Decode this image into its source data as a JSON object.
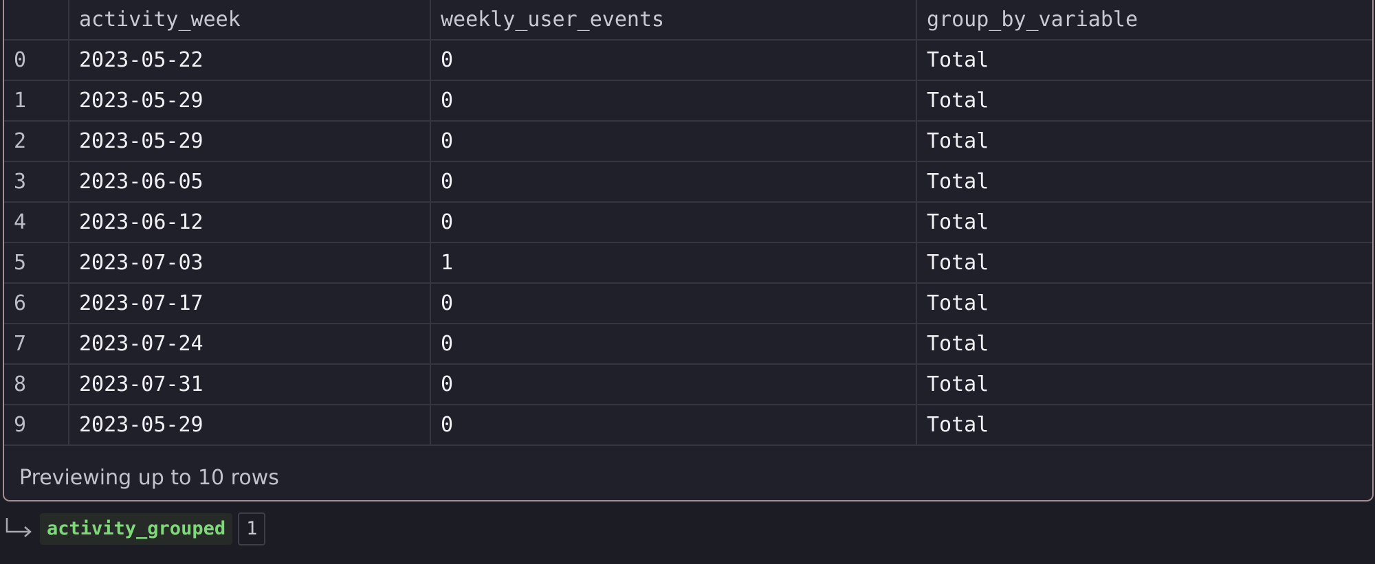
{
  "table": {
    "columns": [
      "",
      "activity_week",
      "weekly_user_events",
      "group_by_variable"
    ],
    "rows": [
      [
        "0",
        "2023-05-22",
        "0",
        "Total"
      ],
      [
        "1",
        "2023-05-29",
        "0",
        "Total"
      ],
      [
        "2",
        "2023-05-29",
        "0",
        "Total"
      ],
      [
        "3",
        "2023-06-05",
        "0",
        "Total"
      ],
      [
        "4",
        "2023-06-12",
        "0",
        "Total"
      ],
      [
        "5",
        "2023-07-03",
        "1",
        "Total"
      ],
      [
        "6",
        "2023-07-17",
        "0",
        "Total"
      ],
      [
        "7",
        "2023-07-24",
        "0",
        "Total"
      ],
      [
        "8",
        "2023-07-31",
        "0",
        "Total"
      ],
      [
        "9",
        "2023-05-29",
        "0",
        "Total"
      ]
    ],
    "footer": "Previewing up to 10 rows"
  },
  "output": {
    "icon": "return-arrow-icon",
    "variable_name": "activity_grouped",
    "count": "1"
  },
  "colors": {
    "background": "#1c1c24",
    "panel": "#1f2029",
    "panel_border": "#a58f93",
    "variable_green": "#7fd87a"
  }
}
